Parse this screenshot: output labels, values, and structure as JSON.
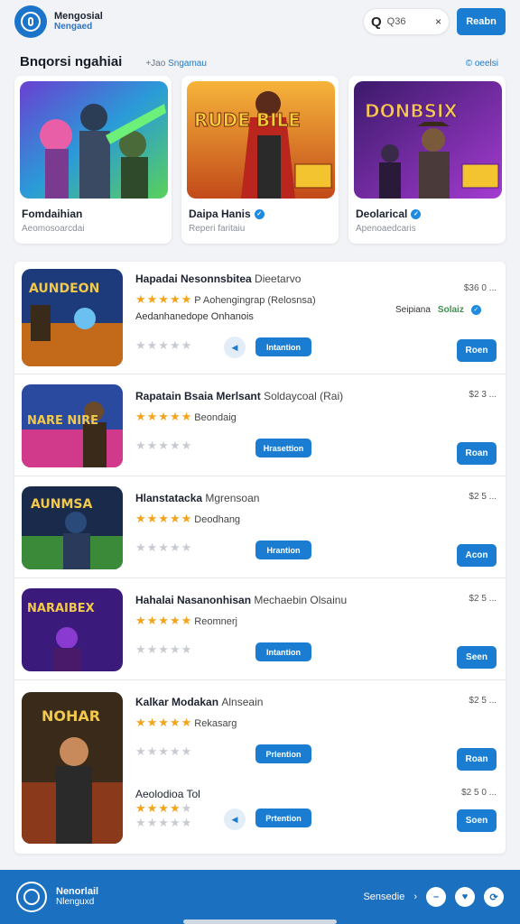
{
  "header": {
    "brand_line1": "Mengosial",
    "brand_line2": "Nengaed",
    "search_value": "Q36",
    "search_clear": "×",
    "action_label": "Reabn"
  },
  "section": {
    "title": "Bnqorsi ngahiai",
    "sub_prefix": "+Jao",
    "sub_link": "Sngamau",
    "more_label": "© oeelsi"
  },
  "featured": [
    {
      "title": "Fomdaihian",
      "subtitle": "Aeomosoarcdai",
      "verified": false
    },
    {
      "title": "Daipa Hanis",
      "subtitle": "Reperi faritaiu",
      "verified": true
    },
    {
      "title": "Deolarical",
      "subtitle": "Apenoaedcaris",
      "verified": true
    }
  ],
  "featured_art_text": [
    "",
    "RUDE BILE",
    "DONBSIX"
  ],
  "list": [
    {
      "art_text": "AUNDEON",
      "title": "Hapadai Nesonnsbitea",
      "title_light": "Dieetarvo",
      "rating_label": "P Aohengingrap (Relosnsa)",
      "sub": "Aedanhanedope Onhanois",
      "price": "$36 0 ...",
      "install_label": "Intantion",
      "open_label": "Roen",
      "pill_left": "Seipiana",
      "pill_right": "Solaiz",
      "stars": 5
    },
    {
      "art_text": "NARE NIRE",
      "title": "Rapatain Bsaia Merlsant",
      "title_light": "Soldaycoal (Rai)",
      "rating_label": "Beondaig",
      "price": "$2 3 ...",
      "install_label": "Hrasettion",
      "open_label": "Roan",
      "stars": 5
    },
    {
      "art_text": "AUNMSA",
      "title": "Hlanstatacka",
      "title_light": "Mgrensoan",
      "rating_label": "Deodhang",
      "price": "$2 5 ...",
      "install_label": "Hrantion",
      "open_label": "Acon",
      "stars": 5
    },
    {
      "art_text": "NARAIBEX",
      "title": "Hahalai Nasanonhisan",
      "title_light": "Mechaebin Olsainu",
      "rating_label": "Reomnerj",
      "price": "$2 5 ...",
      "install_label": "Intantion",
      "open_label": "Seen",
      "stars": 5
    },
    {
      "art_text": "NOHAR",
      "title": "Kalkar Modakan",
      "title_light": "Alnseain",
      "rating_label": "Rekasarg",
      "price": "$2 5 ...",
      "install_label": "Prlention",
      "open_label": "Roan",
      "stars": 5,
      "extra_title": "Aeolodioa Tol",
      "extra_price": "$2 5 0 ...",
      "extra_install": "Prtention",
      "extra_open": "Soen"
    }
  ],
  "footer": {
    "brand_line1": "Nenorlail",
    "brand_line2": "Nlenguxd",
    "nav_label": "Sensedie",
    "nav_arrow": "›"
  },
  "colors": {
    "accent": "#1a7dd1",
    "footer": "#1b70bf",
    "star": "#f3a41b"
  }
}
